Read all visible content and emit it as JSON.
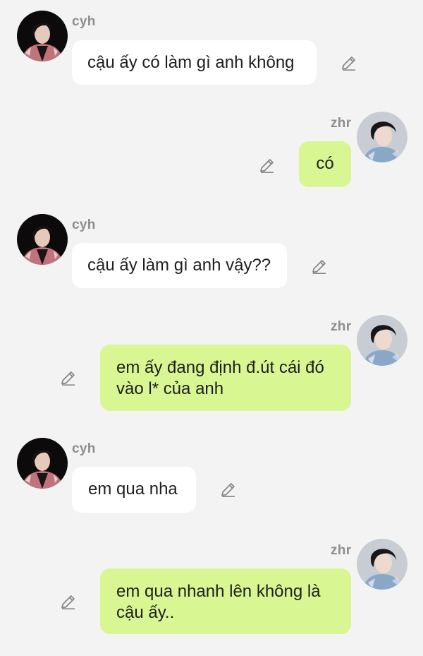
{
  "colors": {
    "background": "#f3f3f3",
    "incoming_bubble": "#ffffff",
    "outgoing_bubble": "#d8f793",
    "name_text": "#8d8d8d"
  },
  "messages": [
    {
      "sender": "cyh",
      "direction": "incoming",
      "text": "cậu ấy có làm gì anh không",
      "icon": "pencil-icon"
    },
    {
      "sender": "zhr",
      "direction": "outgoing",
      "text": "có",
      "icon": "pencil-icon"
    },
    {
      "sender": "cyh",
      "direction": "incoming",
      "text": "cậu ấy làm gì anh vậy??",
      "icon": "pencil-icon"
    },
    {
      "sender": "zhr",
      "direction": "outgoing",
      "lines": [
        "em ấy đang định đ.út cái đó",
        "vào l* của anh"
      ],
      "icon": "pencil-icon"
    },
    {
      "sender": "cyh",
      "direction": "incoming",
      "text": "em qua nha",
      "icon": "pencil-icon"
    },
    {
      "sender": "zhr",
      "direction": "outgoing",
      "lines": [
        "em qua nhanh lên không là",
        "cậu ấy.."
      ],
      "icon": "pencil-icon"
    }
  ]
}
